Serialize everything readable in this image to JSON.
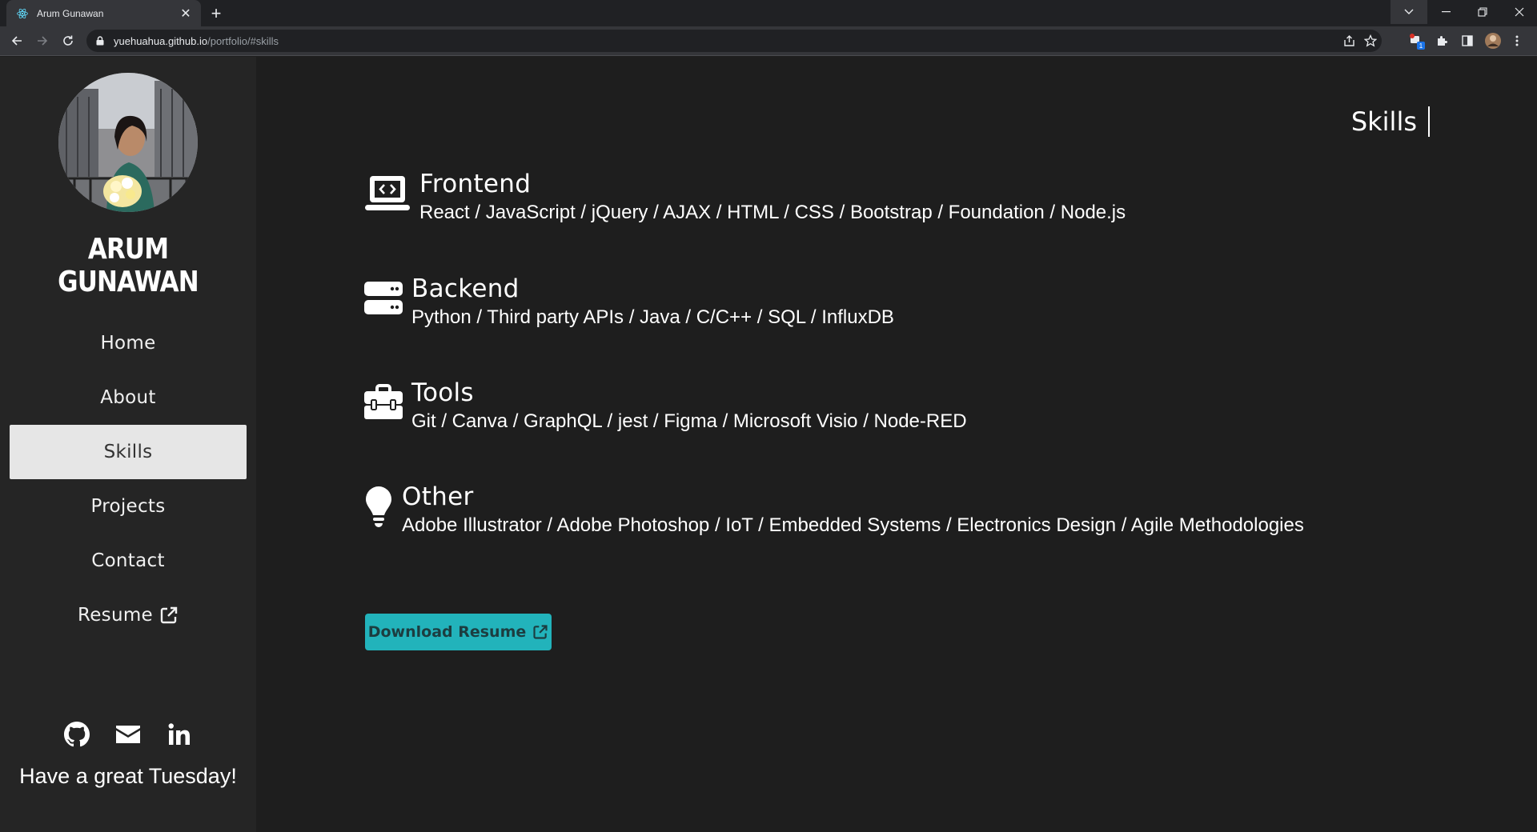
{
  "browser": {
    "tab_title": "Arum Gunawan",
    "url_host": "yuehuahua.github.io",
    "url_path": "/portfolio/#skills",
    "extension_badge": "1"
  },
  "sidebar": {
    "name": "ARUM GUNAWAN",
    "nav": [
      {
        "label": "Home"
      },
      {
        "label": "About"
      },
      {
        "label": "Skills",
        "active": true
      },
      {
        "label": "Projects"
      },
      {
        "label": "Contact"
      },
      {
        "label": "Resume",
        "icon": "external-link-icon"
      }
    ],
    "socials": [
      "github-icon",
      "envelope-icon",
      "linkedin-icon"
    ],
    "greeting": "Have a great Tuesday!"
  },
  "main": {
    "section_title": "Skills",
    "skills": [
      {
        "name": "Frontend",
        "icon": "laptop-code-icon",
        "items": "React / JavaScript / jQuery / AJAX / HTML / CSS / Bootstrap / Foundation / Node.js"
      },
      {
        "name": "Backend",
        "icon": "server-icon",
        "items": "Python / Third party APIs / Java / C/C++ / SQL / InfluxDB"
      },
      {
        "name": "Tools",
        "icon": "toolbox-icon",
        "items": "Git / Canva / GraphQL / jest / Figma / Microsoft Visio / Node-RED"
      },
      {
        "name": "Other",
        "icon": "lightbulb-icon",
        "items": "Adobe Illustrator / Adobe Photoshop / IoT / Embedded Systems / Electronics Design / Agile Methodologies"
      }
    ],
    "download_label": "Download Resume"
  },
  "colors": {
    "page_bg": "#1e1e1e",
    "sidebar_bg": "#252525",
    "accent": "#22b3bb",
    "active_nav_bg": "#e6e6e6"
  }
}
